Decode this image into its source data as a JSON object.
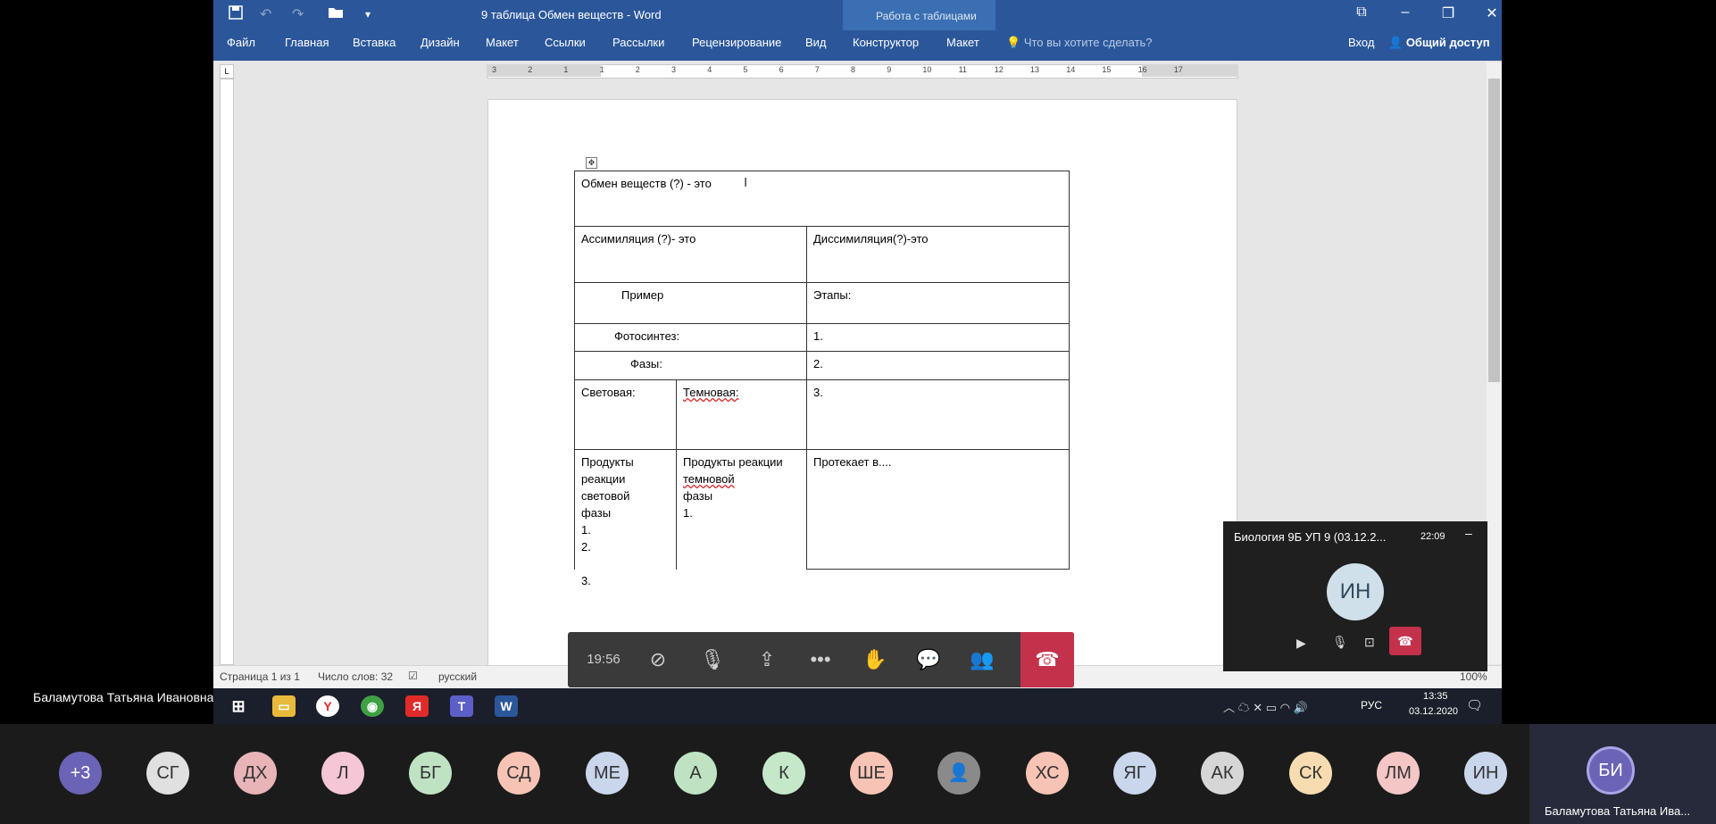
{
  "presenter_name": "Баламутова Татьяна Ивановна",
  "word": {
    "title": "9 таблица Обмен веществ - Word",
    "context_label": "Работа с таблицами",
    "tabs": [
      "Файл",
      "Главная",
      "Вставка",
      "Дизайн",
      "Макет",
      "Ссылки",
      "Рассылки",
      "Рецензирование",
      "Вид",
      "Конструктор",
      "Макет"
    ],
    "tell_me": "Что вы хотите сделать?",
    "signin": "Вход",
    "share": "Общий доступ",
    "ruler_marks": [
      "3",
      "2",
      "1",
      "1",
      "2",
      "3",
      "4",
      "5",
      "6",
      "7",
      "8",
      "9",
      "10",
      "11",
      "12",
      "13",
      "14",
      "15",
      "16",
      "17"
    ],
    "status": {
      "page": "Страница 1 из 1",
      "words": "Число слов: 32",
      "language": "русский",
      "zoom": "100%"
    },
    "table": {
      "r1": "Обмен веществ (?) - это",
      "assim": "Ассимиляция (?)- это",
      "dissim": "Диссимиляция(?)-это",
      "primer": "Пример",
      "etapy": "Этапы:",
      "fotosintez": "Фотосинтез:",
      "n1": "1.",
      "fazy": "Фазы:",
      "n2": "2.",
      "svetovaya": "Световая:",
      "temnovaya": "Темновая:",
      "n3": "3.",
      "prod_svet": [
        "Продукты реакции",
        "световой",
        "фазы",
        "1.",
        "2.",
        "",
        "3."
      ],
      "prod_temn": [
        "Продукты реакции",
        "темновой",
        "фазы",
        "1."
      ],
      "protekaet": "Протекает в...."
    }
  },
  "call": {
    "timer": "19:56",
    "mini_title": "Биология 9Б УП 9 (03.12.2...",
    "mini_time": "22:09",
    "mini_avatar": "ИН"
  },
  "taskbar": {
    "lang": "РУС",
    "time": "13:35",
    "date": "03.12.2020"
  },
  "participants": [
    "+3",
    "СГ",
    "ДХ",
    "Л",
    "БГ",
    "СД",
    "МЕ",
    "А",
    "К",
    "ШЕ",
    "",
    "ХС",
    "ЯГ",
    "АК",
    "СК",
    "ЛМ",
    "ИН"
  ],
  "participant_colors": [
    "#6b63b5",
    "#e0e0e0",
    "#e8b4b8",
    "#f4c6d6",
    "#bfe3c2",
    "#f7c3b5",
    "#c9d6ec",
    "#bfe3c2",
    "#c5e8c8",
    "#f7c3b5",
    "#8a8a8a",
    "#f7c3b5",
    "#c9d6ec",
    "#d6d6d6",
    "#f6dcb0",
    "#f4c6c6",
    "#c9d6ec"
  ],
  "self_avatar": "БИ",
  "self_name": "Баламутова Татьяна Ива..."
}
